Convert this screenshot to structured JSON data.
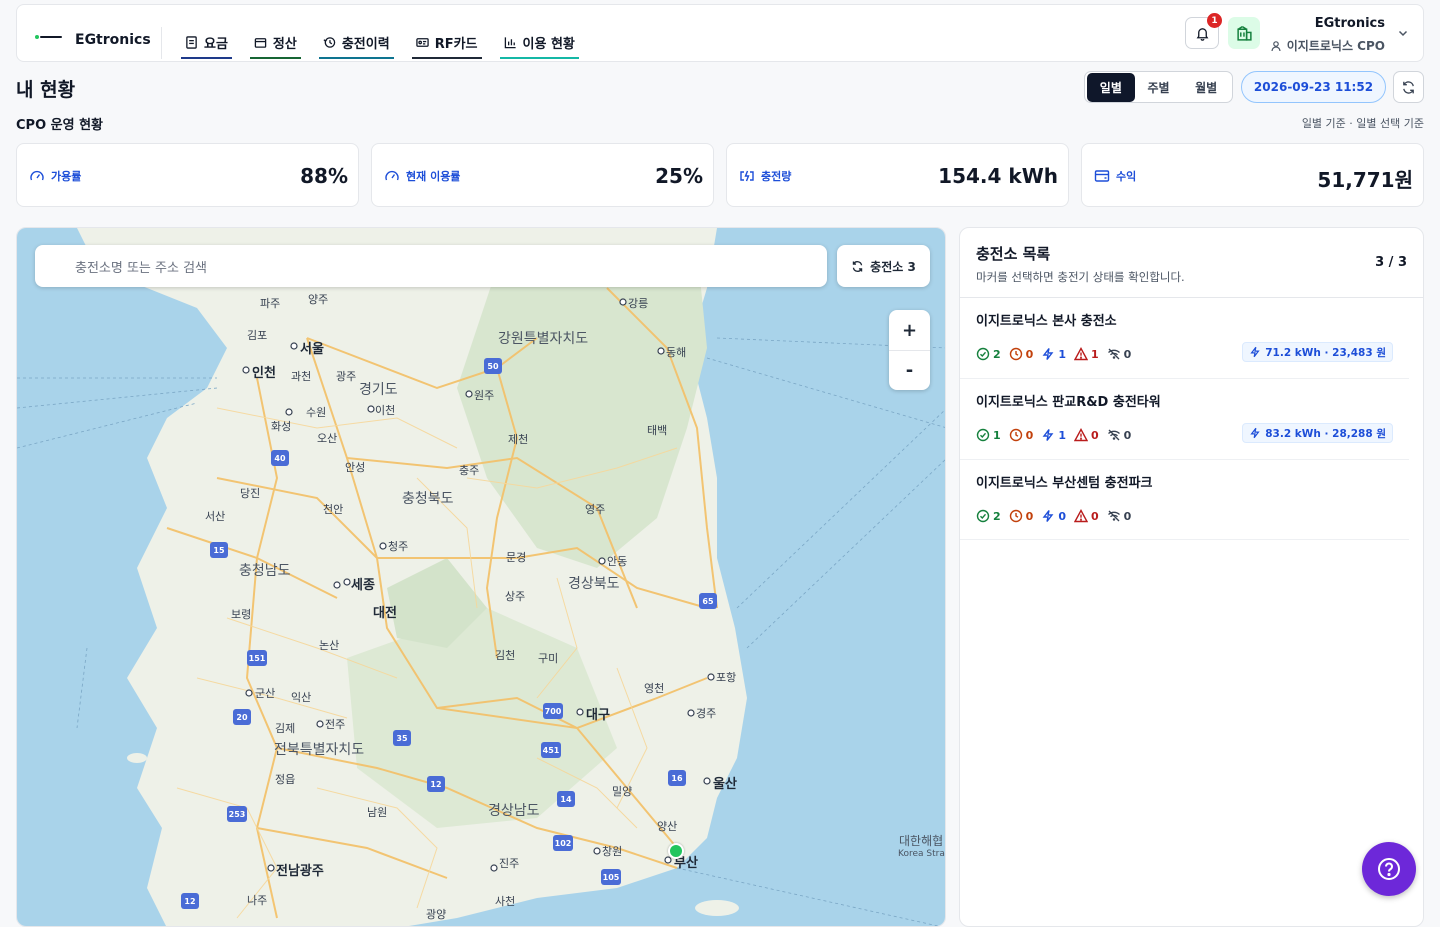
{
  "header": {
    "brand": "EGtronics",
    "nav": [
      {
        "label": "요금",
        "icon": "receipt-icon"
      },
      {
        "label": "정산",
        "icon": "wallet-icon"
      },
      {
        "label": "충전이력",
        "icon": "history-icon"
      },
      {
        "label": "RF카드",
        "icon": "id-card-icon"
      },
      {
        "label": "이용 현황",
        "icon": "bar-chart-icon"
      }
    ],
    "notification_count": "1",
    "user_name": "EGtronics",
    "user_role": "이지트로닉스 CPO"
  },
  "page": {
    "title": "내 현황",
    "period_tabs": [
      "일별",
      "주별",
      "월별"
    ],
    "active_period": "일별",
    "datetime": "2026-09-23 11:52",
    "section_title": "CPO 운영 현황",
    "section_note": "일별 기준 · 일별 선택 기준"
  },
  "kpis": [
    {
      "label": "가용률",
      "value": "88%",
      "icon": "gauge-icon"
    },
    {
      "label": "현재 이용률",
      "value": "25%",
      "icon": "gauge-icon"
    },
    {
      "label": "충전량",
      "value": "154.4 kWh",
      "icon": "battery-charging-icon"
    },
    {
      "label": "수익",
      "value": "51,771원",
      "icon": "wallet-icon"
    }
  ],
  "map": {
    "search_placeholder": "충전소명 또는 주소 검색",
    "station_button": "충전소 3",
    "zoom_in": "+",
    "zoom_out": "-",
    "labels": {
      "seoul": "서울",
      "incheon": "인천",
      "gangwon": "강원특별자치도",
      "gyeonggi": "경기도",
      "chungbuk": "충청북도",
      "chungnam": "충청남도",
      "sejong": "세종",
      "daejeon": "대전",
      "gyeongbuk": "경상북도",
      "daegu": "대구",
      "ulsan": "울산",
      "busan": "부산",
      "gyeongnam": "경상남도",
      "jeonbuk": "전북특별자치도",
      "gwangju": "전남광주",
      "gangneung": "강릉",
      "donghae": "동해",
      "wonju": "원주",
      "suwon": "수원",
      "cheongju": "청주",
      "andong": "안동",
      "pohang": "포항",
      "gyeongju": "경주",
      "jinju": "진주",
      "changwon": "창원",
      "jeonju": "전주",
      "gunsan": "군산",
      "iksan": "익산",
      "chungju": "충주",
      "jecheon": "제천",
      "taebaek": "태백",
      "yeongju": "영주",
      "sangju": "상주",
      "gumi": "구미",
      "gimcheon": "김천",
      "yeongcheon": "영천",
      "miryang": "밀양",
      "yangsan": "양산",
      "cheonan": "천안",
      "dangjin": "당진",
      "seosan": "서산",
      "boryeong": "보령",
      "nonsan": "논산",
      "gimje": "김제",
      "jeongeup": "정읍",
      "namwon": "남원",
      "naju": "나주",
      "sacheon": "사천",
      "gwangyang": "광양",
      "icheon": "이천",
      "osan": "오산",
      "anseong": "안성",
      "hwaseong": "화성",
      "gimpo": "김포",
      "paju": "파주",
      "yangju": "양주",
      "gwacheon": "과천",
      "gwangju_gg": "광주",
      "mungyeong": "문경",
      "sea_korea_strait": "대한해협",
      "sea_korea_strait_en": "Korea Strait"
    }
  },
  "station_list": {
    "title": "충전소 목록",
    "subtitle": "마커를 선택하면 충전기 상태를 확인합니다.",
    "count": "3 / 3",
    "stations": [
      {
        "name": "이지트로닉스 본사 충전소",
        "ok": "2",
        "wait": "0",
        "charging": "1",
        "error": "1",
        "offline": "0",
        "energy": "71.2 kWh · 23,483 원"
      },
      {
        "name": "이지트로닉스 판교R&D 충전타워",
        "ok": "1",
        "wait": "0",
        "charging": "1",
        "error": "0",
        "offline": "0",
        "energy": "83.2 kWh · 28,288 원"
      },
      {
        "name": "이지트로닉스 부산센텀 충전파크",
        "ok": "2",
        "wait": "0",
        "charging": "0",
        "error": "0",
        "offline": "0",
        "energy": ""
      }
    ]
  },
  "colors": {
    "accent": "#1d4ed8",
    "ok": "#15803d",
    "wait": "#c2410c",
    "error": "#b91c1c",
    "fab": "#6d28d9",
    "marker": "#22c55e"
  }
}
